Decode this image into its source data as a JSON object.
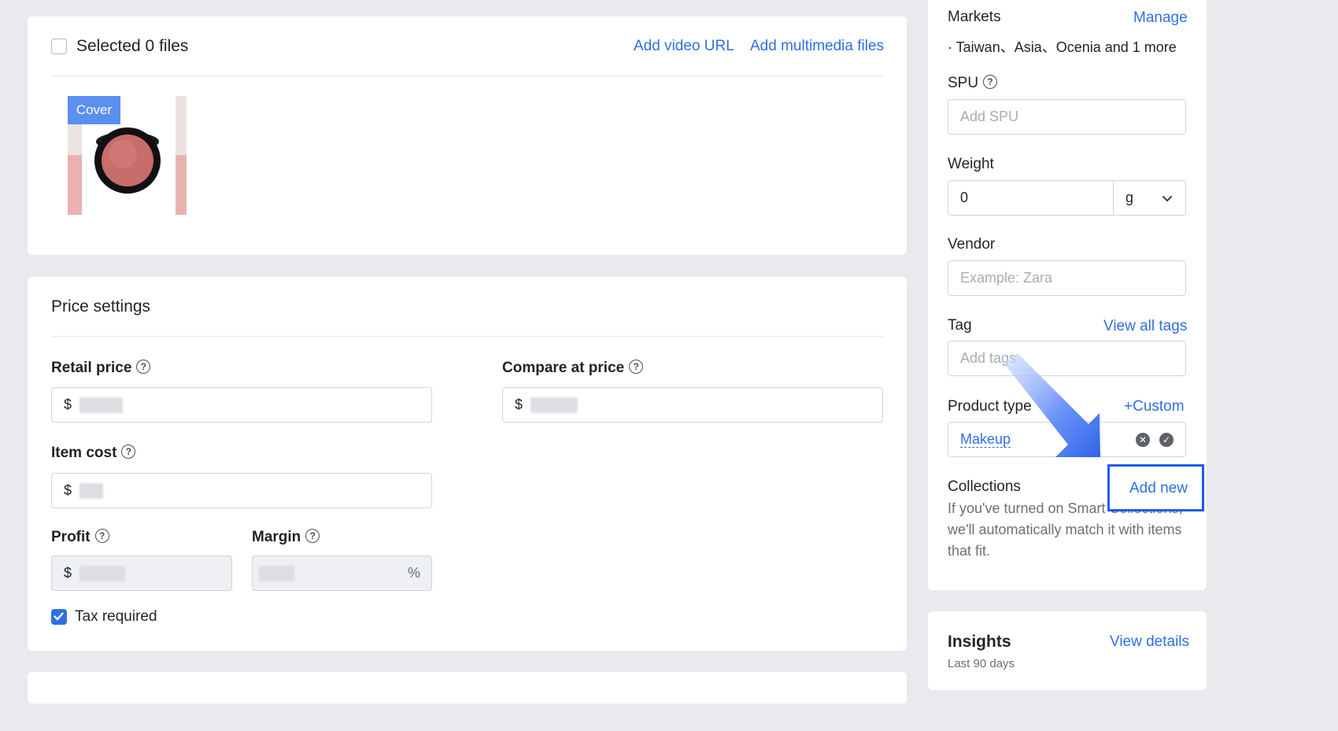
{
  "media": {
    "selected_label": "Selected 0 files",
    "add_video_url": "Add video URL",
    "add_multimedia": "Add multimedia files",
    "cover_badge": "Cover"
  },
  "price": {
    "title": "Price settings",
    "retail_label": "Retail price",
    "compare_label": "Compare at price",
    "item_cost_label": "Item cost",
    "profit_label": "Profit",
    "margin_label": "Margin",
    "currency": "$",
    "percent": "%",
    "tax_label": "Tax required",
    "tax_checked": true
  },
  "sidebar": {
    "markets_label": "Markets",
    "markets_manage": "Manage",
    "markets_value": "· Taiwan、Asia、Ocenia and 1 more",
    "spu_label": "SPU",
    "spu_placeholder": "Add SPU",
    "weight_label": "Weight",
    "weight_value": "0",
    "weight_unit": "g",
    "vendor_label": "Vendor",
    "vendor_placeholder": "Example: Zara",
    "tag_label": "Tag",
    "tag_view_all": "View all tags",
    "tag_placeholder": "Add tags",
    "product_type_label": "Product type",
    "product_type_custom": "+Custom",
    "product_type_value": "Makeup",
    "collections_label": "Collections",
    "collections_add_new": "Add new",
    "collections_help": "If you've turned on Smart Collections, we'll automatically match it with items that fit."
  },
  "insights": {
    "title": "Insights",
    "view_details": "View details",
    "period": "Last 90 days"
  },
  "colors": {
    "accent": "#2f6fe4",
    "highlight_box": "#1a5cf0",
    "background": "#e8eaee"
  }
}
